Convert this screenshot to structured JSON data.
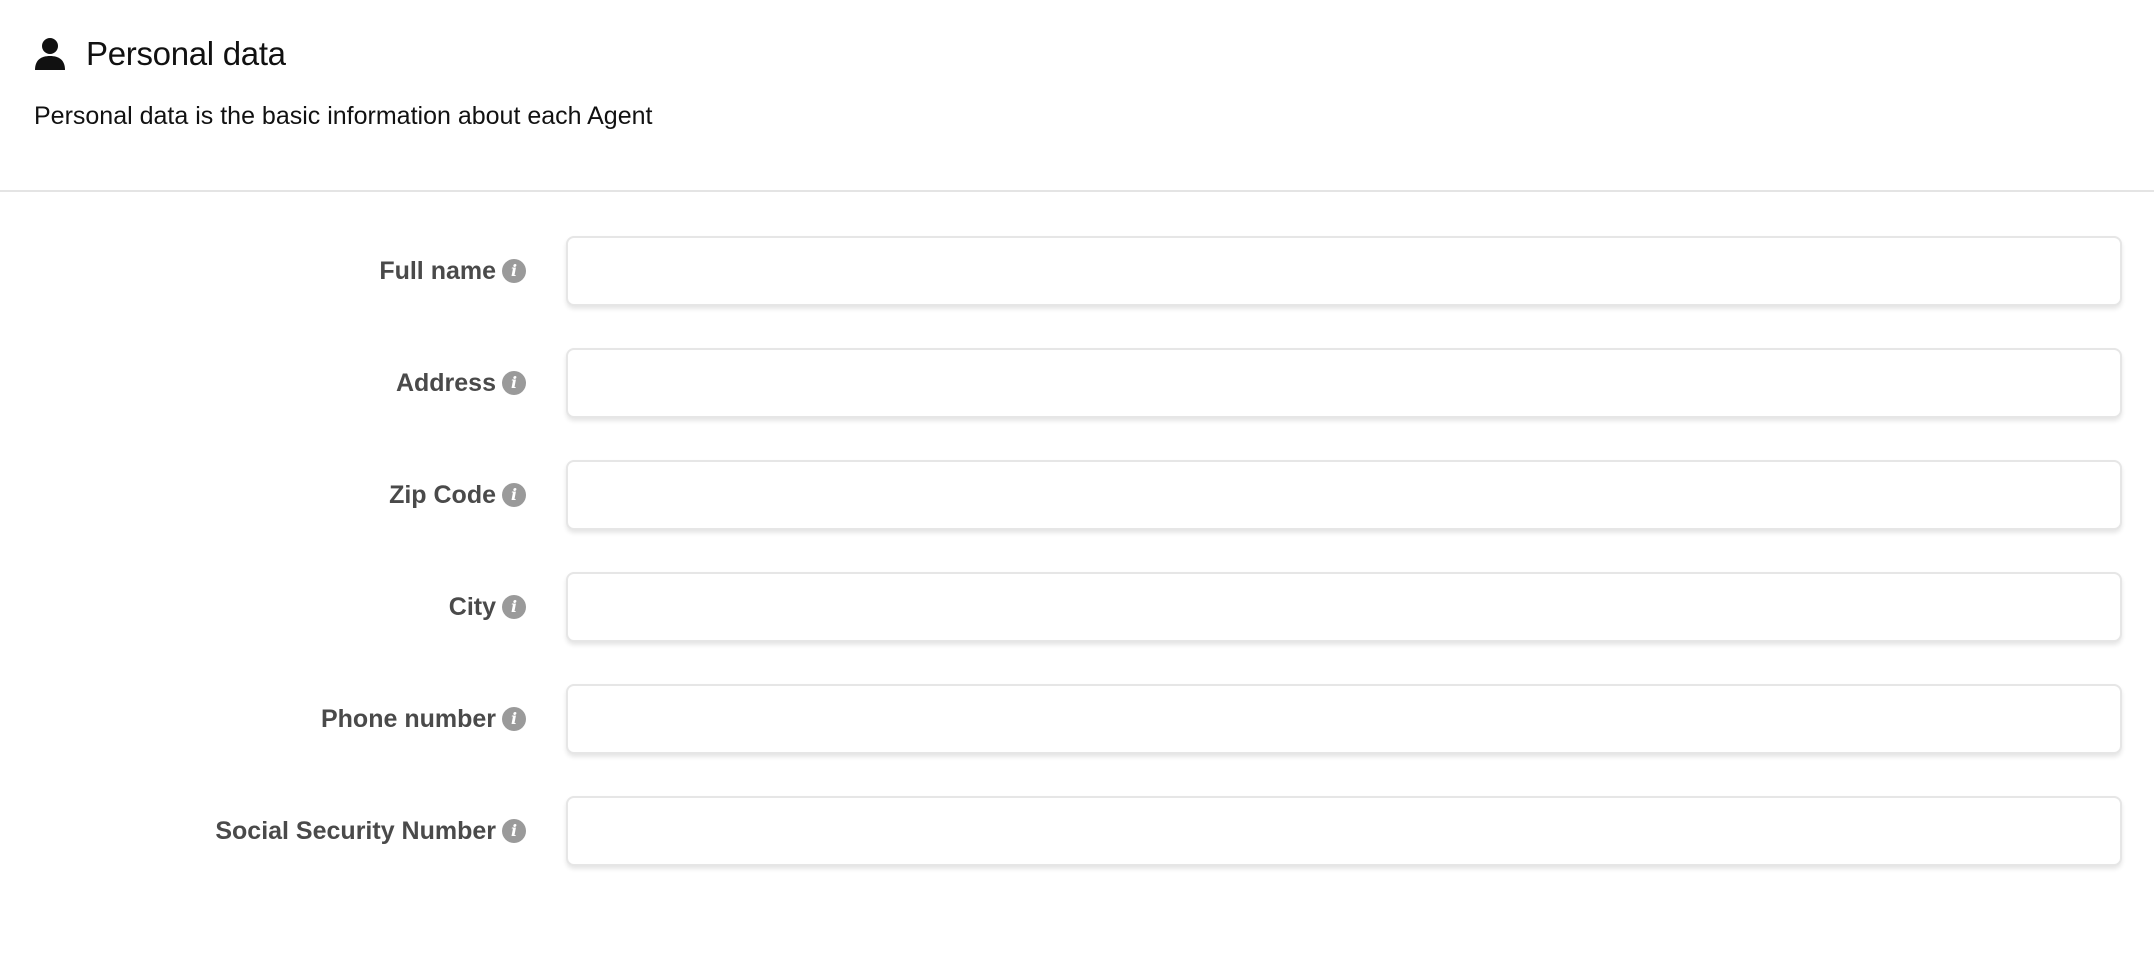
{
  "section": {
    "icon": "user-icon",
    "title": "Personal data",
    "description": "Personal data is the basic information about each Agent"
  },
  "fields": [
    {
      "label": "Full name",
      "value": "",
      "info_icon": "info-icon"
    },
    {
      "label": "Address",
      "value": "",
      "info_icon": "info-icon"
    },
    {
      "label": "Zip Code",
      "value": "",
      "info_icon": "info-icon"
    },
    {
      "label": "City",
      "value": "",
      "info_icon": "info-icon"
    },
    {
      "label": "Phone number",
      "value": "",
      "info_icon": "info-icon"
    },
    {
      "label": "Social Security Number",
      "value": "",
      "info_icon": "info-icon"
    }
  ],
  "colors": {
    "label_text": "#4a4a4a",
    "info_icon_bg": "#9a9a9a",
    "input_border": "#e6e6e6",
    "divider": "#e4e4e4"
  }
}
